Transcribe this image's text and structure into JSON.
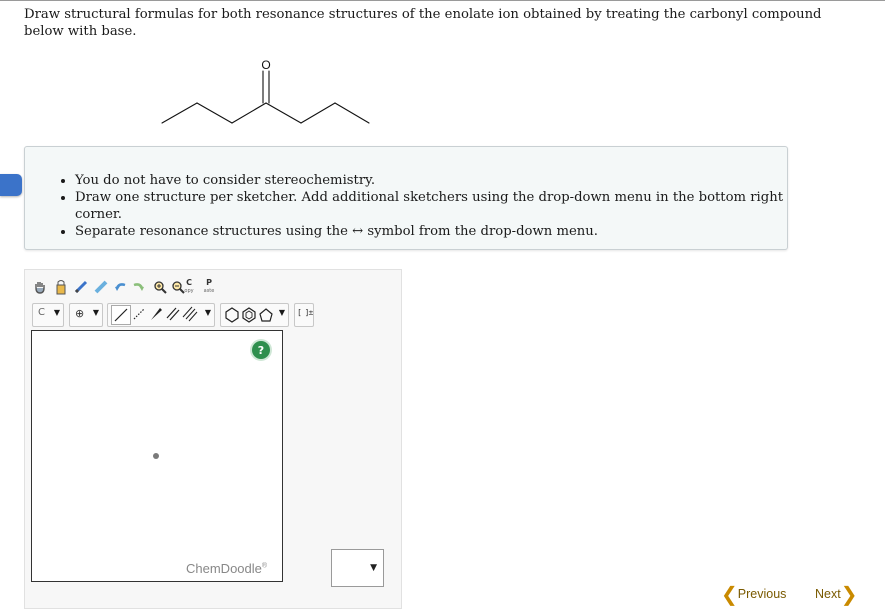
{
  "question": {
    "text": "Draw structural formulas for both resonance structures of the enolate ion obtained by treating the carbonyl compound below with base."
  },
  "molecule": {
    "atom_label": "O"
  },
  "hints": [
    "You do not have to consider stereochemistry.",
    "Draw one structure per sketcher. Add additional sketchers using the drop-down menu in the bottom right corner.",
    "Separate resonance structures using the ↔ symbol from the drop-down menu."
  ],
  "sketcher": {
    "toolbar_row1": {
      "clear_label_top": "C",
      "clear_label_bottom": "opy",
      "paste_label_top": "P",
      "paste_label_bottom": "aste"
    },
    "toolbar_row2": {
      "atom_label": "C",
      "charge_label": "⊕",
      "bracket_label": "[ ]±"
    },
    "help_label": "?",
    "watermark": "ChemDoodle",
    "watermark_mark": "®"
  },
  "sketcher_dropdown": {
    "value": ""
  },
  "nav": {
    "previous_label": "Previous",
    "next_label": "Next"
  },
  "colors": {
    "accent": "#3b73c9",
    "help": "#2f8f4e",
    "nav_chevron": "#c98a00"
  }
}
